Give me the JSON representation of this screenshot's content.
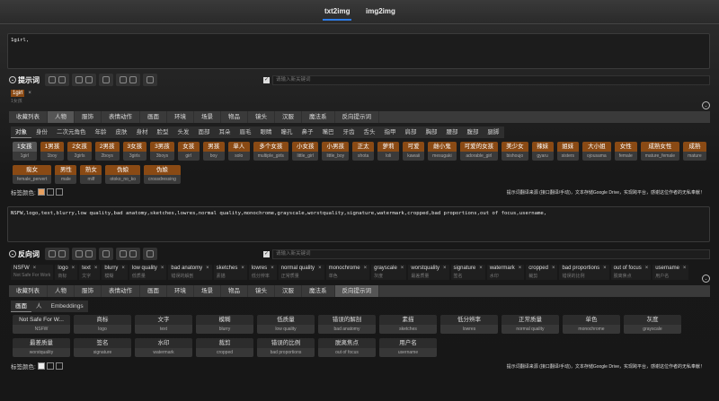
{
  "header": {
    "tabs": [
      "txt2img",
      "img2img"
    ],
    "active": "txt2img"
  },
  "prompt": {
    "value": "1girl,",
    "label": "提示词",
    "keyword_placeholder": "请输入新关键词",
    "tags": [
      {
        "en": "1girl",
        "zh": "1女孩"
      }
    ]
  },
  "categories": [
    "收藏列表",
    "人物",
    "服饰",
    "表情动作",
    "画面",
    "环境",
    "场景",
    "物品",
    "镜头",
    "汉服",
    "魔法系",
    "反向提示词"
  ],
  "person": {
    "active_category": "人物",
    "subtabs": [
      "对象",
      "身份",
      "二次元角色",
      "年龄",
      "皮肤",
      "身材",
      "脸型",
      "头发",
      "面部",
      "耳朵",
      "眉毛",
      "眼睛",
      "瞳孔",
      "鼻子",
      "嘴巴",
      "牙齿",
      "舌头",
      "指甲",
      "肩部",
      "胸部",
      "腰部",
      "腹部",
      "腿脚"
    ],
    "active_subtab": "对象",
    "cards": [
      [
        "1女孩",
        "1girl"
      ],
      [
        "1男孩",
        "1boy"
      ],
      [
        "2女孩",
        "2girls"
      ],
      [
        "2男孩",
        "2boys"
      ],
      [
        "3女孩",
        "3girls"
      ],
      [
        "3男孩",
        "3boys"
      ],
      [
        "女孩",
        "girl"
      ],
      [
        "男孩",
        "boy"
      ],
      [
        "单人",
        "solo"
      ],
      [
        "多个女孩",
        "multiple_girls"
      ],
      [
        "小女孩",
        "little_girl"
      ],
      [
        "小男孩",
        "little_boy"
      ],
      [
        "正太",
        "shota"
      ],
      [
        "萝莉",
        "loli"
      ],
      [
        "可爱",
        "kawaii"
      ],
      [
        "雌小鬼",
        "mesugaki"
      ],
      [
        "可爱的女孩",
        "adorable_girl"
      ],
      [
        "美少女",
        "bishoujo"
      ],
      [
        "辣妹",
        "gyaru"
      ],
      [
        "姐妹",
        "sisters"
      ],
      [
        "大小姐",
        "ojousama"
      ],
      [
        "女性",
        "female"
      ],
      [
        "成熟女性",
        "mature_female"
      ],
      [
        "成熟",
        "mature"
      ],
      [
        "痴女",
        "female_pervert"
      ],
      [
        "男性",
        "male"
      ],
      [
        "熟女",
        "milf"
      ],
      [
        "伪娘",
        "otoko_no_ko"
      ],
      [
        "伪娘",
        "crossdressing"
      ]
    ],
    "selected": "1girl"
  },
  "tag_color_label": "标签颜色:",
  "notice": "提示词翻译来源 (接口翻译/手动)，文本存储Google Drive，实现跨平台，感谢这位作者的无私奉献！",
  "negative": {
    "value": "NSFW,logo,text,blurry,low quality,bad anatomy,sketches,lowres,normal quality,monochrome,grayscale,worstquality,signature,watermark,cropped,bad proportions,out of focus,username,",
    "label": "反向词",
    "keyword_placeholder": "请输入新关键词",
    "tags": [
      [
        "NSFW",
        "Not Safe For Work"
      ],
      [
        "logo",
        "商标"
      ],
      [
        "text",
        "文字"
      ],
      [
        "blurry",
        "模糊"
      ],
      [
        "low quality",
        "低质量"
      ],
      [
        "bad anatomy",
        "错误的解剖"
      ],
      [
        "sketches",
        "素描"
      ],
      [
        "lowres",
        "低分辨率"
      ],
      [
        "normal quality",
        "正常质量"
      ],
      [
        "monochrome",
        "单色"
      ],
      [
        "grayscale",
        "灰度"
      ],
      [
        "worstquality",
        "最差质量"
      ],
      [
        "signature",
        "签名"
      ],
      [
        "watermark",
        "水印"
      ],
      [
        "cropped",
        "裁剪"
      ],
      [
        "bad proportions",
        "错误的比例"
      ],
      [
        "out of focus",
        "脱离焦点"
      ],
      [
        "username",
        "用户名"
      ]
    ],
    "active_category": "反向提示词",
    "subtabs": [
      "画面",
      "人",
      "Embeddings"
    ],
    "active_subtab": "画面",
    "cards": [
      [
        "Not Safe For W...",
        "NSFW"
      ],
      [
        "商标",
        "logo"
      ],
      [
        "文字",
        "text"
      ],
      [
        "模糊",
        "blurry"
      ],
      [
        "低质量",
        "low quality"
      ],
      [
        "错误的解剖",
        "bad anatomy"
      ],
      [
        "素描",
        "sketches"
      ],
      [
        "低分辨率",
        "lowres"
      ],
      [
        "正常质量",
        "normal quality"
      ],
      [
        "单色",
        "monochrome"
      ],
      [
        "灰度",
        "grayscale"
      ],
      [
        "最差质量",
        "worstquality"
      ],
      [
        "签名",
        "signature"
      ],
      [
        "水印",
        "watermark"
      ],
      [
        "裁剪",
        "cropped"
      ],
      [
        "错误的比例",
        "bad proportions"
      ],
      [
        "脱离焦点",
        "out of focus"
      ],
      [
        "用户名",
        "username"
      ]
    ]
  },
  "colors": {
    "accent": "#2d7be5",
    "tag_orange": "#8a4a14"
  }
}
